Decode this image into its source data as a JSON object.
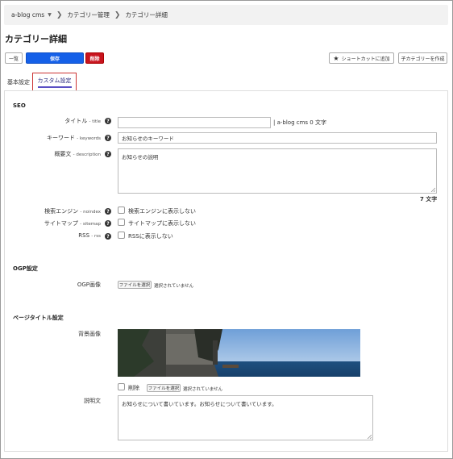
{
  "breadcrumb": {
    "items": [
      "a-blog cms",
      "カテゴリー管理",
      "カテゴリー詳細"
    ]
  },
  "page_title": "カテゴリー詳細",
  "toolbar": {
    "list_label": "一覧",
    "save_label": "保存",
    "delete_label": "削除",
    "shortcut_label": "ショートカットに追加",
    "child_label": "子カテゴリーを作成"
  },
  "tabs": {
    "basic": "基本設定",
    "custom": "カスタム設定"
  },
  "seo": {
    "heading": "SEO",
    "title_label": "タイトル",
    "title_key": "title",
    "title_value": "",
    "title_suffix": "| a-blog cms 0 文字",
    "keywords_label": "キーワード",
    "keywords_key": "keywords",
    "keywords_value": "お知らせのキーワード",
    "description_label": "概要文",
    "description_key": "description",
    "description_value": "お知らせの説明",
    "char_count": "7 文字",
    "noindex_label": "検索エンジン",
    "noindex_key": "noindex",
    "noindex_option": "検索エンジンに表示しない",
    "sitemap_label": "サイトマップ",
    "sitemap_key": "sitemap",
    "sitemap_option": "サイトマップに表示しない",
    "rss_label": "RSS",
    "rss_key": "rss",
    "rss_option": "RSSに表示しない"
  },
  "ogp": {
    "heading": "OGP設定",
    "image_label": "OGP画像",
    "file_button": "ファイルを選択",
    "file_status": "選択されていません"
  },
  "page_title_settings": {
    "heading": "ページタイトル設定",
    "bg_label": "背景画像",
    "delete_option": "削除",
    "file_button": "ファイルを選択",
    "file_status": "選択されていません",
    "desc_label": "説明文",
    "desc_value": "お知らせについて書いています。お知らせについて書いています。"
  },
  "colors": {
    "primary": "#1560e8",
    "danger": "#c8141e",
    "tab_active_border": "#cc3333",
    "tab_underline": "#5a4fc4"
  },
  "icons": [
    "chevron-right-icon",
    "caret-down-icon",
    "star-icon",
    "help-icon",
    "resize-grip-icon"
  ]
}
